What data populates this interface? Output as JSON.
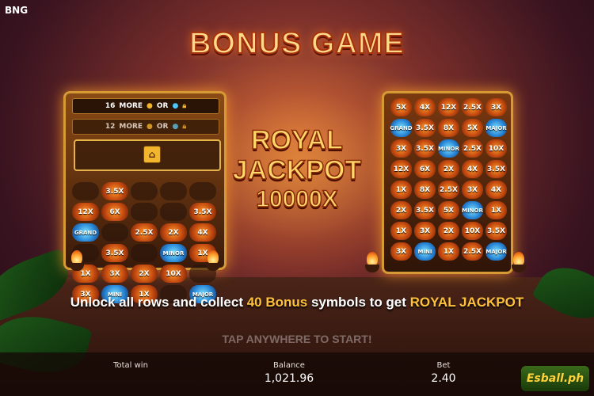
{
  "brand": "BNG",
  "title": "BONUS GAME",
  "left_panel": {
    "lock_row_1": {
      "count": "16",
      "more": "MORE",
      "or": "OR"
    },
    "lock_row_2": {
      "count": "12",
      "more": "MORE",
      "or": "OR"
    },
    "grid": [
      [
        "",
        "3.5X",
        "",
        "",
        ""
      ],
      [
        "12X",
        "6X",
        "",
        "",
        "3.5X"
      ],
      [
        "GRAND",
        "",
        "2.5X",
        "2X",
        "4X"
      ],
      [
        "",
        "3.5X",
        "",
        "MINOR",
        "1X"
      ],
      [
        "1X",
        "3X",
        "2X",
        "10X",
        ""
      ],
      [
        "3X",
        "MINI",
        "1X",
        "",
        "MAJOR"
      ]
    ]
  },
  "right_panel": {
    "grid": [
      [
        "5X",
        "4X",
        "12X",
        "2.5X",
        "3X"
      ],
      [
        "GRAND",
        "3.5X",
        "8X",
        "5X",
        "MAJOR"
      ],
      [
        "3X",
        "3.5X",
        "MINOR",
        "2.5X",
        "10X"
      ],
      [
        "12X",
        "6X",
        "2X",
        "4X",
        "3.5X"
      ],
      [
        "1X",
        "8X",
        "2.5X",
        "3X",
        "4X"
      ],
      [
        "2X",
        "3.5X",
        "5X",
        "MINOR",
        "1X"
      ],
      [
        "1X",
        "3X",
        "2X",
        "10X",
        "3.5X"
      ],
      [
        "3X",
        "MINI",
        "1X",
        "2.5X",
        "MAJOR"
      ]
    ]
  },
  "jackpot": {
    "line1": "ROYAL",
    "line2": "JACKPOT",
    "line3": "10000X"
  },
  "instruction": {
    "part1": "Unlock all rows and collect ",
    "highlight1": "40 Bonus",
    "part2": " symbols to get ",
    "highlight2": "ROYAL JACKPOT"
  },
  "tap_text": "TAP ANYWHERE TO START!",
  "stats": {
    "total_win_label": "Total win",
    "total_win_value": "",
    "balance_label": "Balance",
    "balance_value": "1,021.96",
    "bet_label": "Bet",
    "bet_value": "2.40"
  },
  "logo_text": "Esball.ph",
  "colors": {
    "accent": "#ffc23a",
    "title": "#ffd98a"
  }
}
